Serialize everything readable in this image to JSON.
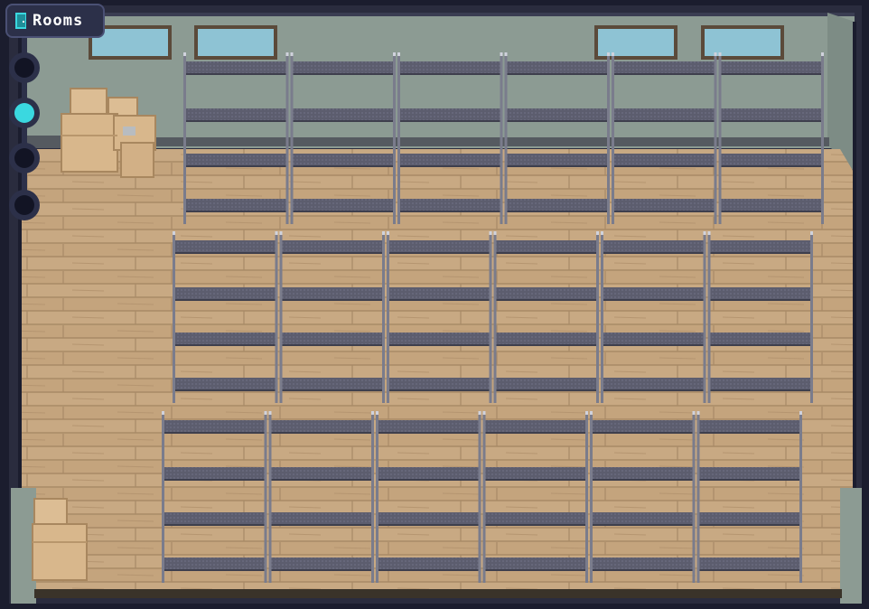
{
  "hud": {
    "rooms_label": "Rooms",
    "door_icon": "door-icon",
    "room_selector": {
      "count": 4,
      "active_index": 1,
      "active_color": "#3ad8e0",
      "inactive_color": "#121424"
    }
  },
  "scene": {
    "room": "warehouse",
    "shelf_rows": 3,
    "shelves_per_row": 6,
    "colors": {
      "wall": "#8a9a90",
      "floor": "#c2a27d",
      "shelf_frame": "#6f7180",
      "shelf_board": "#5a5b6c",
      "window_glass": "#8ec3d4",
      "box": "#d9b88e"
    }
  }
}
